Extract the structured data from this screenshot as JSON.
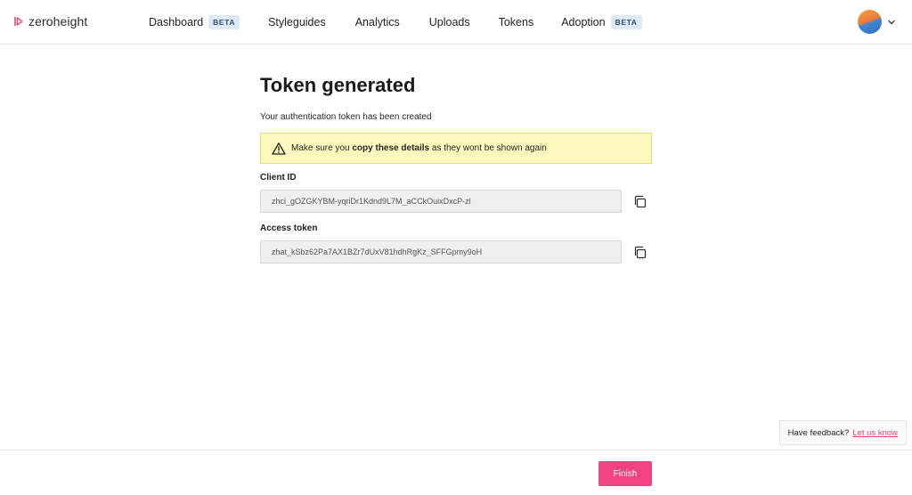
{
  "app": {
    "name": "zeroheight"
  },
  "nav": {
    "items": [
      {
        "label": "Dashboard",
        "badge": "BETA"
      },
      {
        "label": "Styleguides",
        "badge": ""
      },
      {
        "label": "Analytics",
        "badge": ""
      },
      {
        "label": "Uploads",
        "badge": ""
      },
      {
        "label": "Tokens",
        "badge": ""
      },
      {
        "label": "Adoption",
        "badge": "BETA"
      }
    ]
  },
  "page": {
    "title": "Token generated",
    "subtitle": "Your authentication token has been created",
    "warning": {
      "prefix": "Make sure you ",
      "bold": "copy these details",
      "suffix": " as they wont be shown again"
    },
    "client_id": {
      "label": "Client ID",
      "value": "zhci_gOZGKYBM-yqriDr1Kdnd9L7M_aCCkOuixDxcP-zl"
    },
    "access_token": {
      "label": "Access token",
      "value": "zhat_kSbz62Pa7AX1BZr7dUxV81hdhRgKz_SFFGpmy9oH"
    }
  },
  "feedback": {
    "text": "Have feedback?",
    "link": "Let us know"
  },
  "footer": {
    "finish_label": "Finish"
  },
  "colors": {
    "brand_pink": "#f0437f",
    "warning_bg": "#fdf8bd",
    "badge_bg": "#dde9f7",
    "link": "#e0457b"
  },
  "icons": {
    "logo": "zeroheight-logo-icon",
    "avatar_menu": "chevron-down-icon",
    "warning": "warning-triangle-icon",
    "copy": "copy-icon"
  }
}
